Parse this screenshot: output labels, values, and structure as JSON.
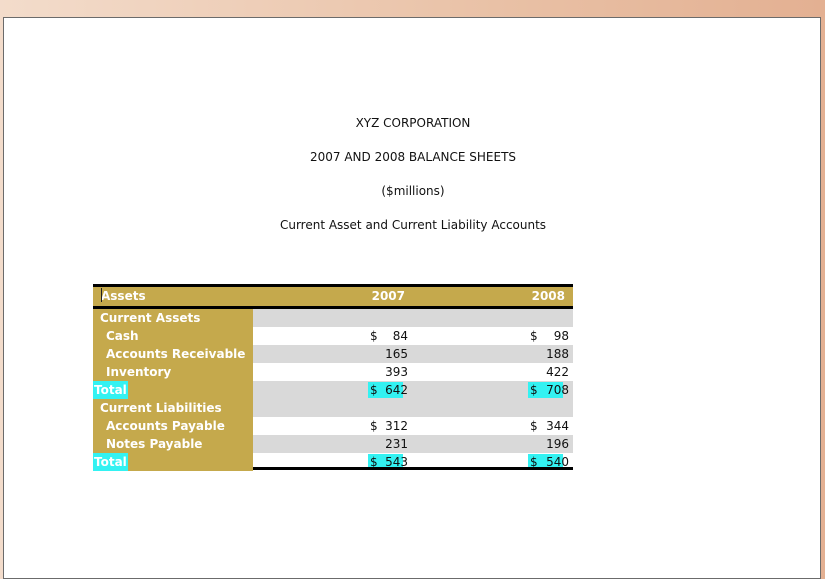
{
  "heading": {
    "company": "XYZ CORPORATION",
    "title": "2007 AND 2008 BALANCE SHEETS",
    "units": "($millions)",
    "subtitle": "Current Asset and Current Liability Accounts"
  },
  "table": {
    "header": {
      "label": "Assets",
      "col1": "2007",
      "col2": "2008"
    },
    "rows": [
      {
        "label": "Current Assets",
        "dollar1": "",
        "v1": "",
        "dollar2": "",
        "v2": ""
      },
      {
        "label": "Cash",
        "dollar1": "$",
        "v1": "84",
        "dollar2": "$",
        "v2": "98"
      },
      {
        "label": "Accounts Receivable",
        "dollar1": "",
        "v1": "165",
        "dollar2": "",
        "v2": "188"
      },
      {
        "label": "Inventory",
        "dollar1": "",
        "v1": "393",
        "dollar2": "",
        "v2": "422"
      },
      {
        "label": "Total",
        "dollar1": "$",
        "v1": "642",
        "dollar2": "$",
        "v2": "708"
      },
      {
        "label": "Current Liabilities",
        "dollar1": "",
        "v1": "",
        "dollar2": "",
        "v2": ""
      },
      {
        "label": "Accounts Payable",
        "dollar1": "$",
        "v1": "312",
        "dollar2": "$",
        "v2": "344"
      },
      {
        "label": "Notes Payable",
        "dollar1": "",
        "v1": "231",
        "dollar2": "",
        "v2": "196"
      },
      {
        "label": "Total",
        "dollar1": "$",
        "v1": "543",
        "dollar2": "$",
        "v2": "540"
      }
    ]
  },
  "colors": {
    "label_fill": "#c5a94c",
    "highlight": "#33f2f2",
    "band": "#d9d9d9"
  }
}
